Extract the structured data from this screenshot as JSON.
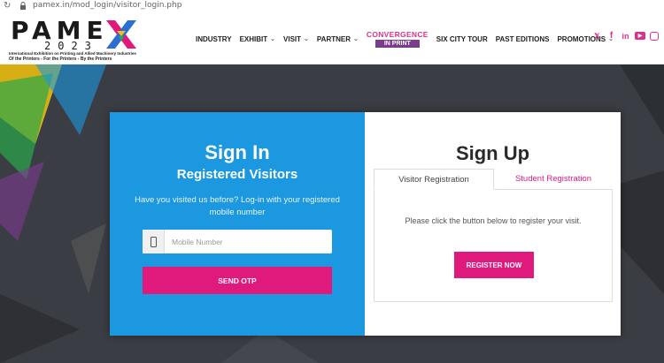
{
  "browser": {
    "url": "pamex.in/mod_login/visitor_login.php"
  },
  "logo": {
    "word": "PAME",
    "year": "2023",
    "tagline1": "International Exhibition on Printing and Allied Machinery Industries",
    "tagline2": "Of the Printers - For the Printers - By the Printers"
  },
  "nav": {
    "items": [
      {
        "label": "INDUSTRY",
        "dropdown": false
      },
      {
        "label": "EXHIBIT",
        "dropdown": true
      },
      {
        "label": "VISIT",
        "dropdown": true
      },
      {
        "label": "PARTNER",
        "dropdown": true
      }
    ],
    "convergence": {
      "line1": "CONVERGENCE",
      "line2": "IN PRINT"
    },
    "items2": [
      {
        "label": "SIX CITY TOUR",
        "dropdown": false
      },
      {
        "label": "PAST EDITIONS",
        "dropdown": false
      },
      {
        "label": "PROMOTIONS",
        "dropdown": true
      }
    ]
  },
  "social": [
    "twitter-icon",
    "facebook-icon",
    "linkedin-icon",
    "youtube-icon",
    "instagram-icon"
  ],
  "signin": {
    "title": "Sign In",
    "subtitle": "Registered Visitors",
    "description": "Have you visited us before? Log-in with your registered mobile number",
    "mobile_placeholder": "Mobile Number",
    "mobile_value": "",
    "otp_button": "SEND OTP"
  },
  "signup": {
    "title": "Sign Up",
    "tabs": [
      "Visitor Registration",
      "Student Registration"
    ],
    "active_tab": "Visitor Registration",
    "panel_text": "Please click the button below to register your visit.",
    "register_button": "REGISTER NOW"
  },
  "colors": {
    "accent_pink": "#e0197d",
    "signin_blue": "#1b98e0",
    "convergence_purple": "#7b3b8f",
    "hero_dark": "#3b3d44"
  }
}
